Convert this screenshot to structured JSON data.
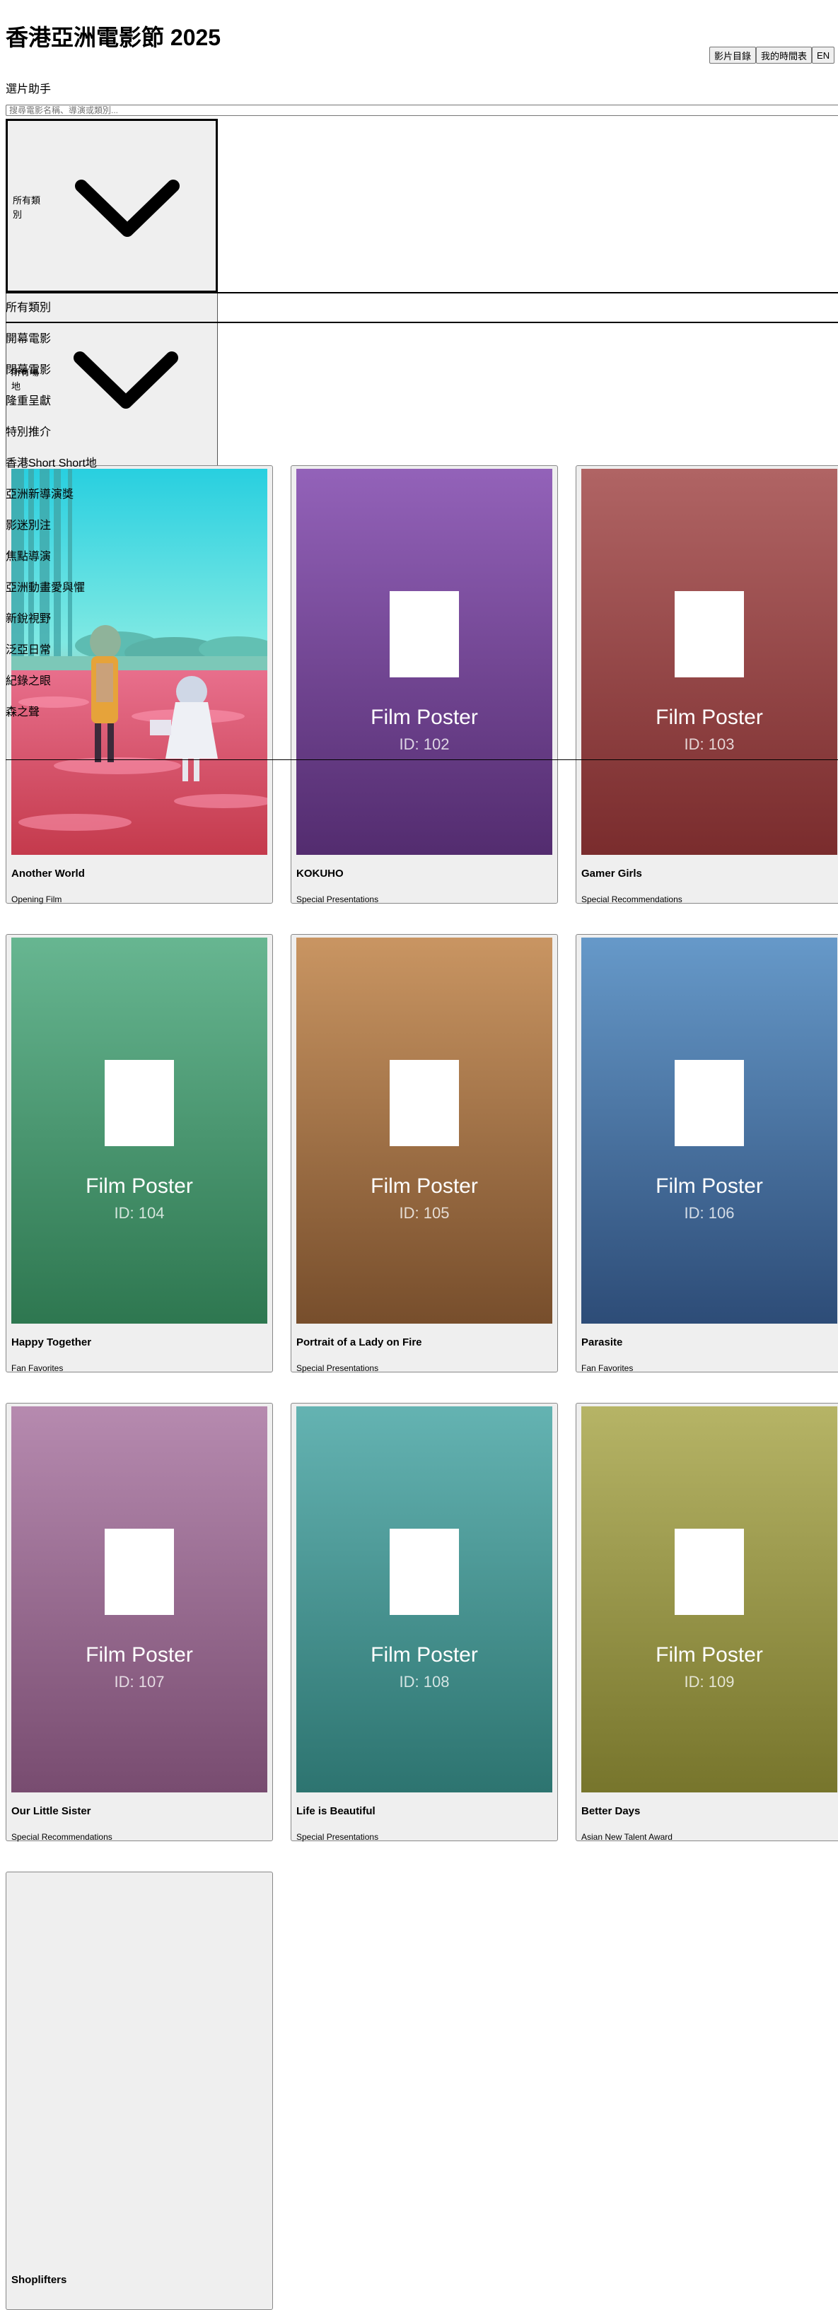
{
  "header": {
    "title": "香港亞洲電影節 2025",
    "nav": [
      "影片目錄",
      "我的時間表",
      "EN"
    ],
    "subtitle": "選片助手"
  },
  "search": {
    "placeholder": "搜尋電影名稱、導演或類別..."
  },
  "filters": {
    "category_selected": "所有類別",
    "venue_selected": "所有場地",
    "options": [
      "所有類別",
      "開幕電影",
      "閉幕電影",
      "隆重呈獻",
      "特別推介",
      "香港Short Short地",
      "亞洲新導演獎",
      "影迷別注",
      "焦點導演",
      "亞洲動畫愛與懼",
      "新銳視野",
      "泛亞日常",
      "紀錄之眼",
      "森之聲"
    ]
  },
  "films": [
    {
      "title": "Another World",
      "category": "Opening Film",
      "poster_label": "",
      "poster_id": "",
      "colors": [
        "#28cfe0",
        "#d84a6a"
      ]
    },
    {
      "title": "KOKUHO",
      "category": "Special Presentations",
      "poster_label": "Film Poster",
      "poster_id": "ID: 102",
      "colors": [
        "#9362b9",
        "#532c6f"
      ]
    },
    {
      "title": "Gamer Girls",
      "category": "Special Recommendations",
      "poster_label": "Film Poster",
      "poster_id": "ID: 103",
      "colors": [
        "#b06464",
        "#7a2c2d"
      ]
    },
    {
      "title": "Happy Together",
      "category": "Fan Favorites",
      "poster_label": "Film Poster",
      "poster_id": "ID: 104",
      "colors": [
        "#67b691",
        "#2e7750"
      ]
    },
    {
      "title": "Portrait of a Lady on Fire",
      "category": "Special Presentations",
      "poster_label": "Film Poster",
      "poster_id": "ID: 105",
      "colors": [
        "#c99562",
        "#774e2c"
      ]
    },
    {
      "title": "Parasite",
      "category": "Fan Favorites",
      "poster_label": "Film Poster",
      "poster_id": "ID: 106",
      "colors": [
        "#6699c9",
        "#2d4c77"
      ]
    },
    {
      "title": "Our Little Sister",
      "category": "Special Recommendations",
      "poster_label": "Film Poster",
      "poster_id": "ID: 107",
      "colors": [
        "#b68aaf",
        "#784c70"
      ]
    },
    {
      "title": "Life is Beautiful",
      "category": "Special Presentations",
      "poster_label": "Film Poster",
      "poster_id": "ID: 108",
      "colors": [
        "#64b3b2",
        "#2d7470"
      ]
    },
    {
      "title": "Better Days",
      "category": "Asian New Talent Award",
      "poster_label": "Film Poster",
      "poster_id": "ID: 109",
      "colors": [
        "#b6b466",
        "#77752c"
      ]
    },
    {
      "title": "Shoplifters",
      "category": "",
      "poster_label": "",
      "poster_id": "",
      "colors": [
        "#efefef",
        "#efefef"
      ]
    }
  ]
}
